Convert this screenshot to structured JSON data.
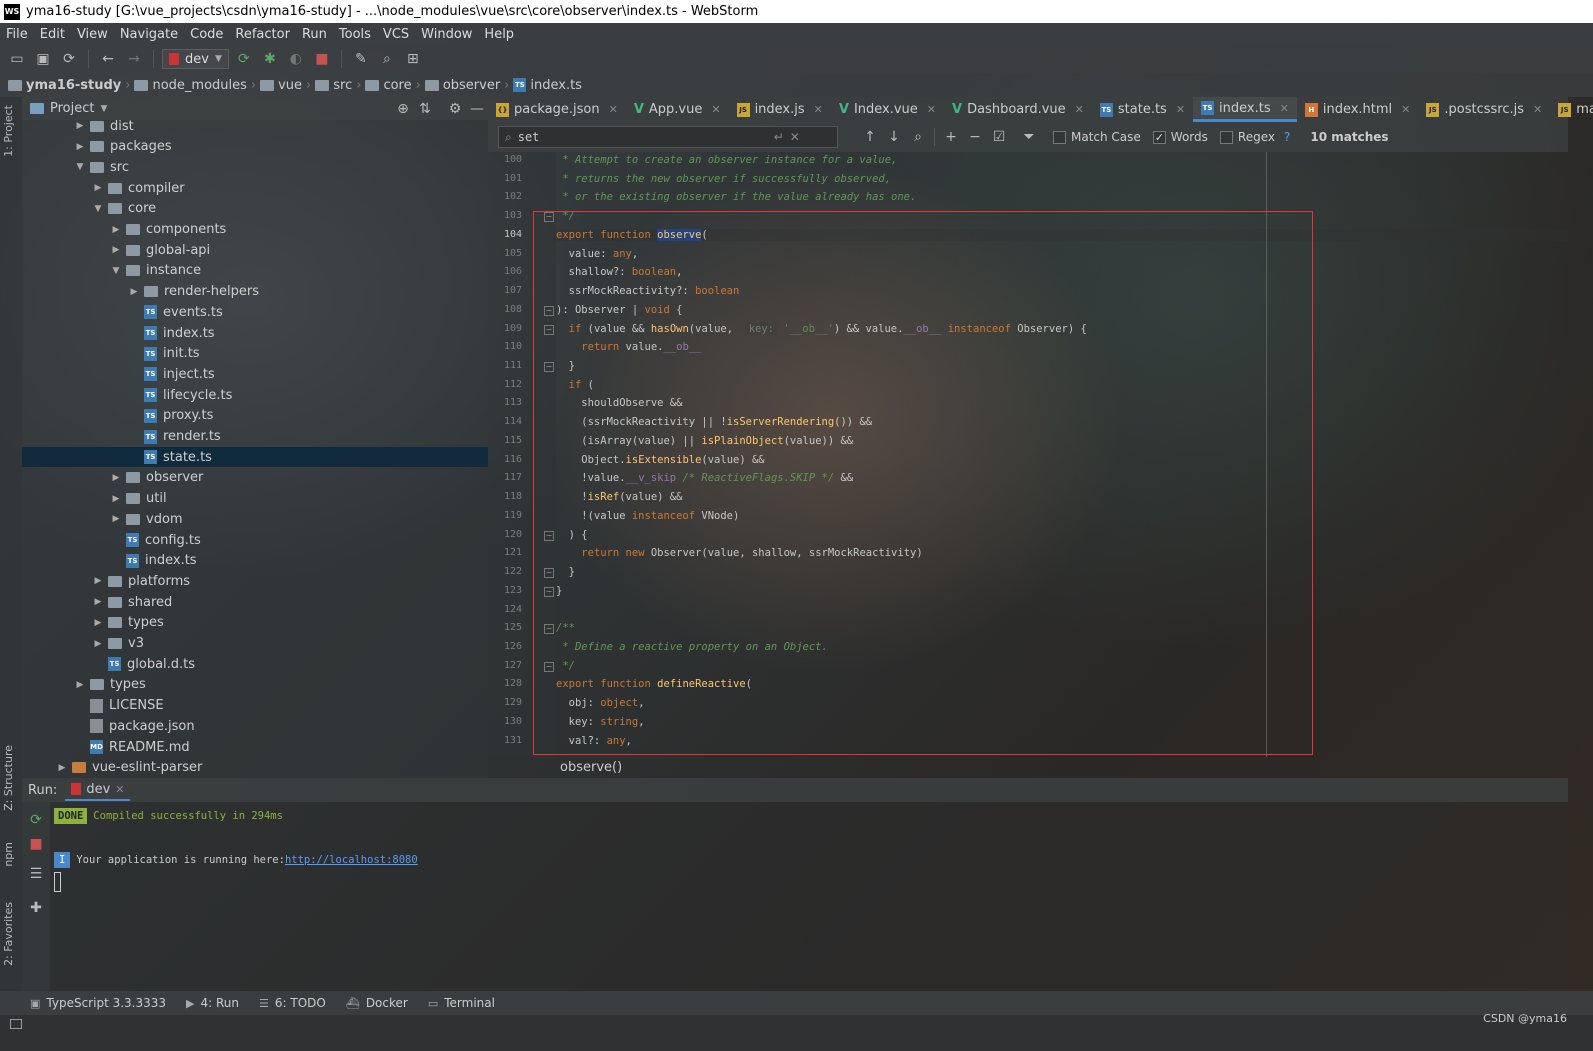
{
  "window": {
    "title": "yma16-study [G:\\vue_projects\\csdn\\yma16-study] - ...\\node_modules\\vue\\src\\core\\observer\\index.ts - WebStorm",
    "logo": "WS"
  },
  "menu": [
    "File",
    "Edit",
    "View",
    "Navigate",
    "Code",
    "Refactor",
    "Run",
    "Tools",
    "VCS",
    "Window",
    "Help"
  ],
  "toolbar": {
    "run_config": "dev"
  },
  "breadcrumb": [
    "yma16-study",
    "node_modules",
    "vue",
    "src",
    "core",
    "observer",
    "index.ts"
  ],
  "side_labels": {
    "project": "1: Project",
    "structure": "Z: Structure",
    "npm": "npm",
    "favorites": "2: Favorites"
  },
  "project_panel": {
    "title": "Project",
    "tree": [
      {
        "label": "dist",
        "type": "folder",
        "depth": 3,
        "arrow": "▶",
        "color": "gray"
      },
      {
        "label": "packages",
        "type": "folder",
        "depth": 3,
        "arrow": "▶",
        "color": "gray"
      },
      {
        "label": "src",
        "type": "folder",
        "depth": 3,
        "arrow": "▼",
        "color": "gray"
      },
      {
        "label": "compiler",
        "type": "folder",
        "depth": 4,
        "arrow": "▶",
        "color": "gray"
      },
      {
        "label": "core",
        "type": "folder",
        "depth": 4,
        "arrow": "▼",
        "color": "gray"
      },
      {
        "label": "components",
        "type": "folder",
        "depth": 5,
        "arrow": "▶",
        "color": "gray"
      },
      {
        "label": "global-api",
        "type": "folder",
        "depth": 5,
        "arrow": "▶",
        "color": "gray"
      },
      {
        "label": "instance",
        "type": "folder",
        "depth": 5,
        "arrow": "▼",
        "color": "gray"
      },
      {
        "label": "render-helpers",
        "type": "folder",
        "depth": 6,
        "arrow": "▶",
        "color": "gray"
      },
      {
        "label": "events.ts",
        "type": "ts",
        "depth": 6,
        "arrow": ""
      },
      {
        "label": "index.ts",
        "type": "ts",
        "depth": 6,
        "arrow": ""
      },
      {
        "label": "init.ts",
        "type": "ts",
        "depth": 6,
        "arrow": ""
      },
      {
        "label": "inject.ts",
        "type": "ts",
        "depth": 6,
        "arrow": ""
      },
      {
        "label": "lifecycle.ts",
        "type": "ts",
        "depth": 6,
        "arrow": ""
      },
      {
        "label": "proxy.ts",
        "type": "ts",
        "depth": 6,
        "arrow": ""
      },
      {
        "label": "render.ts",
        "type": "ts",
        "depth": 6,
        "arrow": ""
      },
      {
        "label": "state.ts",
        "type": "ts",
        "depth": 6,
        "arrow": "",
        "selected": true
      },
      {
        "label": "observer",
        "type": "folder",
        "depth": 5,
        "arrow": "▶",
        "color": "gray"
      },
      {
        "label": "util",
        "type": "folder",
        "depth": 5,
        "arrow": "▶",
        "color": "gray"
      },
      {
        "label": "vdom",
        "type": "folder",
        "depth": 5,
        "arrow": "▶",
        "color": "gray"
      },
      {
        "label": "config.ts",
        "type": "ts",
        "depth": 5,
        "arrow": ""
      },
      {
        "label": "index.ts",
        "type": "ts",
        "depth": 5,
        "arrow": ""
      },
      {
        "label": "platforms",
        "type": "folder",
        "depth": 4,
        "arrow": "▶",
        "color": "gray"
      },
      {
        "label": "shared",
        "type": "folder",
        "depth": 4,
        "arrow": "▶",
        "color": "gray"
      },
      {
        "label": "types",
        "type": "folder",
        "depth": 4,
        "arrow": "▶",
        "color": "gray"
      },
      {
        "label": "v3",
        "type": "folder",
        "depth": 4,
        "arrow": "▶",
        "color": "gray"
      },
      {
        "label": "global.d.ts",
        "type": "ts",
        "depth": 4,
        "arrow": ""
      },
      {
        "label": "types",
        "type": "folder",
        "depth": 3,
        "arrow": "▶",
        "color": "gray"
      },
      {
        "label": "LICENSE",
        "type": "file",
        "depth": 3,
        "arrow": ""
      },
      {
        "label": "package.json",
        "type": "file",
        "depth": 3,
        "arrow": ""
      },
      {
        "label": "README.md",
        "type": "md",
        "depth": 3,
        "arrow": ""
      },
      {
        "label": "vue-eslint-parser",
        "type": "folder",
        "depth": 2,
        "arrow": "▶",
        "color": "orange"
      }
    ]
  },
  "tabs": [
    {
      "label": "package.json",
      "icon": "json"
    },
    {
      "label": "App.vue",
      "icon": "vue"
    },
    {
      "label": "index.js",
      "icon": "js"
    },
    {
      "label": "Index.vue",
      "icon": "vue"
    },
    {
      "label": "Dashboard.vue",
      "icon": "vue"
    },
    {
      "label": "state.ts",
      "icon": "ts"
    },
    {
      "label": "index.ts",
      "icon": "ts",
      "active": true
    },
    {
      "label": "index.html",
      "icon": "html"
    },
    {
      "label": ".postcssrc.js",
      "icon": "js"
    },
    {
      "label": "main.js",
      "icon": "js"
    }
  ],
  "search": {
    "value": "set",
    "match_case": "Match Case",
    "words": "Words",
    "regex": "Regex",
    "help": "?",
    "matches": "10 matches"
  },
  "code": {
    "current_line": 104,
    "lines": [
      {
        "n": 100,
        "html": "<span class=\"cmt\"> * Attempt to create an observer instance for a value,</span>"
      },
      {
        "n": 101,
        "html": "<span class=\"cmt\"> * returns the new observer if successfully observed,</span>"
      },
      {
        "n": 102,
        "html": "<span class=\"cmt\"> * or the existing observer if the value already has one.</span>"
      },
      {
        "n": 103,
        "html": "<span class=\"cmt\"> */</span>",
        "fold": "-"
      },
      {
        "n": 104,
        "html": "<span class=\"kw\">export function </span><span class=\"hl\">observe</span>(",
        "current": true
      },
      {
        "n": 105,
        "html": "  value: <span class=\"kw\">any</span>,"
      },
      {
        "n": 106,
        "html": "  shallow?: <span class=\"kw\">boolean</span>,"
      },
      {
        "n": 107,
        "html": "  ssrMockReactivity?: <span class=\"kw\">boolean</span>"
      },
      {
        "n": 108,
        "html": "): Observer | <span class=\"kw\">void</span> {",
        "fold": "-"
      },
      {
        "n": 109,
        "html": "  <span class=\"kw\">if</span> (value &amp;&amp; <span class=\"fn\">hasOwn</span>(value,  <span class=\"hint\">key:</span> <span class=\"str\">'__ob__'</span>) &amp;&amp; value.<span class=\"prop\">__ob__</span> <span class=\"kw\">instanceof</span> Observer) {",
        "fold": "-"
      },
      {
        "n": 110,
        "html": "    <span class=\"kw\">return</span> value.<span class=\"prop\">__ob__</span>"
      },
      {
        "n": 111,
        "html": "  }",
        "fold": "-"
      },
      {
        "n": 112,
        "html": "  <span class=\"kw\">if</span> ("
      },
      {
        "n": 113,
        "html": "    shouldObserve &amp;&amp;"
      },
      {
        "n": 114,
        "html": "    (ssrMockReactivity || !<span class=\"fn\">isServerRendering</span>()) &amp;&amp;"
      },
      {
        "n": 115,
        "html": "    (isArray(value) || <span class=\"fn\">isPlainObject</span>(value)) &amp;&amp;"
      },
      {
        "n": 116,
        "html": "    Object.<span class=\"fn\">isExtensible</span>(value) &amp;&amp;"
      },
      {
        "n": 117,
        "html": "    !value.<span class=\"prop\">__v_skip</span> <span class=\"cmt\">/* ReactiveFlags.SKIP */</span> &amp;&amp;"
      },
      {
        "n": 118,
        "html": "    !<span class=\"fn\">isRef</span>(value) &amp;&amp;"
      },
      {
        "n": 119,
        "html": "    !(value <span class=\"kw\">instanceof</span> VNode)"
      },
      {
        "n": 120,
        "html": "  ) {",
        "fold": "-"
      },
      {
        "n": 121,
        "html": "    <span class=\"kw\">return new</span> Observer(value, shallow, ssrMockReactivity)"
      },
      {
        "n": 122,
        "html": "  }",
        "fold": "-"
      },
      {
        "n": 123,
        "html": "}",
        "fold": "-"
      },
      {
        "n": 124,
        "html": ""
      },
      {
        "n": 125,
        "html": "<span class=\"cmt\">/**</span>",
        "fold": "-"
      },
      {
        "n": 126,
        "html": "<span class=\"cmt\"> * Define a reactive property on an Object.</span>"
      },
      {
        "n": 127,
        "html": "<span class=\"cmt\"> */</span>",
        "fold": "-"
      },
      {
        "n": 128,
        "html": "<span class=\"kw\">export function </span><span class=\"fn\">defineReactive</span>("
      },
      {
        "n": 129,
        "html": "  obj: <span class=\"kw\">object</span>,"
      },
      {
        "n": 130,
        "html": "  key: <span class=\"kw\">string</span>,"
      },
      {
        "n": 131,
        "html": "  val?: <span class=\"kw\">any</span>,"
      }
    ],
    "crumb": "observe()"
  },
  "run": {
    "label": "Run:",
    "tab": "dev",
    "done_badge": "DONE",
    "done_text": "Compiled successfully in 294ms",
    "info_badge": "I",
    "info_text": "Your application is running here: ",
    "url": "http://localhost:8080"
  },
  "statusbar": [
    {
      "label": "TypeScript 3.3.3333",
      "icon": "ts"
    },
    {
      "label": "4: Run",
      "icon": "play"
    },
    {
      "label": "6: TODO",
      "icon": "list"
    },
    {
      "label": "Docker",
      "icon": "docker"
    },
    {
      "label": "Terminal",
      "icon": "terminal"
    }
  ],
  "watermark": "CSDN @yma16",
  "colors": {
    "accent": "#4a88c7",
    "selection": "#0d293e",
    "red_box": "#e0363e",
    "done": "#8bb33a"
  }
}
